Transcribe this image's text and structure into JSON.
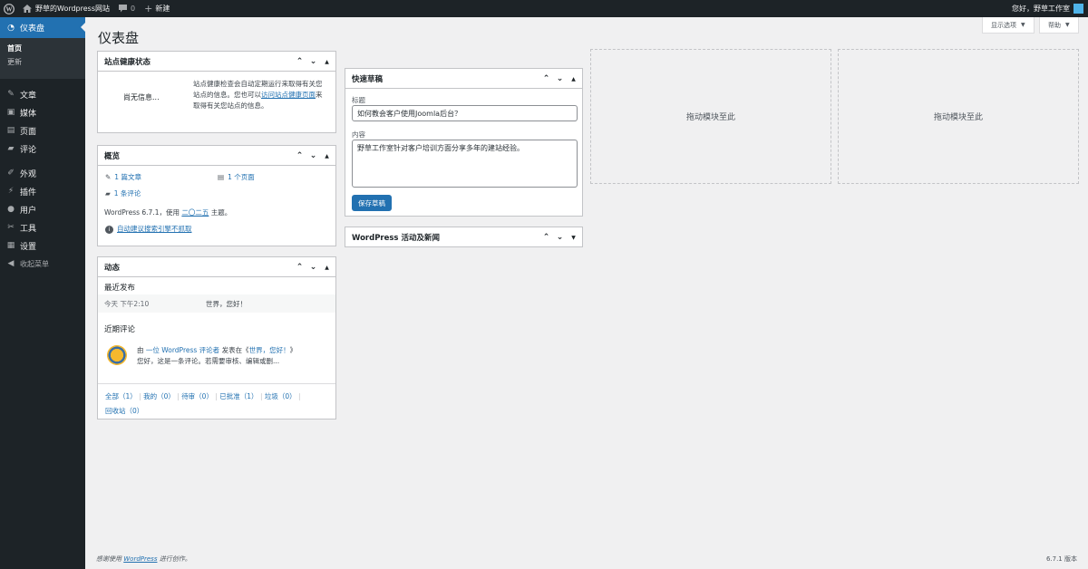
{
  "adminbar": {
    "site_name": "野草的Wordpress网站",
    "comments_count": "0",
    "new_label": "新建",
    "greeting": "您好，野草工作室"
  },
  "sidebar": {
    "dashboard": "仪表盘",
    "submenu": [
      "首页",
      "更新"
    ],
    "items": [
      {
        "label": "文章",
        "icon": "pin-icon"
      },
      {
        "label": "媒体",
        "icon": "media-icon"
      },
      {
        "label": "页面",
        "icon": "page-icon"
      },
      {
        "label": "评论",
        "icon": "comment-icon"
      },
      {
        "label": "外观",
        "icon": "brush-icon"
      },
      {
        "label": "插件",
        "icon": "plugin-icon"
      },
      {
        "label": "用户",
        "icon": "user-icon"
      },
      {
        "label": "工具",
        "icon": "wrench-icon"
      },
      {
        "label": "设置",
        "icon": "settings-icon"
      }
    ],
    "collapse": "收起菜单"
  },
  "header": {
    "title": "仪表盘",
    "screen_options": "显示选项",
    "help": "帮助"
  },
  "site_health": {
    "title": "站点健康状态",
    "no_info": "尚无信息...",
    "desc_1": "站点健康检查会自动定期运行来取得有关您",
    "desc_2a": "站点的信息。您也可以",
    "desc_link": "访问站点健康页面",
    "desc_2b": "来",
    "desc_3": "取得有关您站点的信息。"
  },
  "glance": {
    "title": "概览",
    "posts": "1 篇文章",
    "pages": "1 个页面",
    "comments": "1 条评论",
    "version_prefix": "WordPress 6.7.1，使用",
    "theme_link": "二〇二五",
    "version_suffix": "主题。",
    "notice": "自动建议搜索引擎不抓取"
  },
  "activity": {
    "title": "动态",
    "recent_published": "最近发布",
    "pub_time": "今天 下午2:10",
    "pub_title": "世界，您好！",
    "recent_comments": "近期评论",
    "comment_from": "由",
    "comment_author": "一位 WordPress 评论者",
    "comment_on": "发表在《",
    "comment_post": "世界，您好！",
    "comment_close": "》",
    "comment_excerpt": "您好，这是一条评论。若需要审核、编辑或删...",
    "filters": [
      "全部（1）",
      "我的（0）",
      "待审（0）",
      "已批准（1）",
      "垃圾（0）",
      "回收站（0）"
    ]
  },
  "quick_draft": {
    "title": "快速草稿",
    "title_label": "标题",
    "title_value": "如何教会客户使用Joomla后台？",
    "content_label": "内容",
    "content_value": "野草工作室针对客户培训方面分享多年的建站经验。",
    "save_button": "保存草稿"
  },
  "news": {
    "title": "WordPress 活动及新闻"
  },
  "dropzones": [
    "拖动模块至此",
    "拖动模块至此"
  ],
  "footer": {
    "thanks_prefix": "感谢使用",
    "thanks_link": "WordPress",
    "thanks_suffix": "进行创作。",
    "version": "6.7.1 版本"
  },
  "colors": {
    "adminbar_bg": "#1d2327",
    "accent": "#2271b1",
    "page_bg": "#f0f0f1"
  }
}
